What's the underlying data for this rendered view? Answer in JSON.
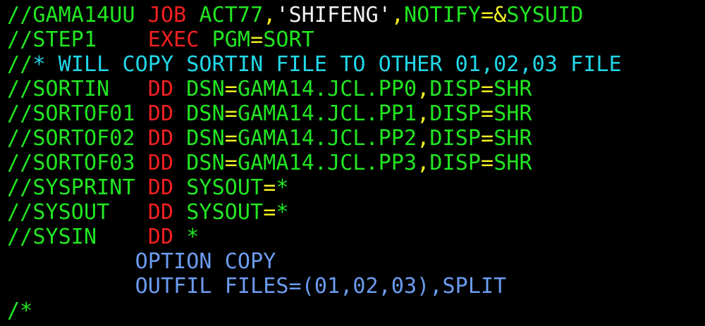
{
  "colors": {
    "background": "#000000",
    "green": "#22e622",
    "red": "#f22020",
    "yellow": "#f2f222",
    "cyan": "#22d8e8",
    "blue": "#6c9cf0",
    "white": "#f2f2f2"
  },
  "lines": [
    {
      "name": "jcl-job-card",
      "segments": [
        {
          "text": "//GAMA14UU ",
          "color": "green"
        },
        {
          "text": "JOB",
          "color": "red"
        },
        {
          "text": " ACT77",
          "color": "green"
        },
        {
          "text": ",",
          "color": "yellow"
        },
        {
          "text": "'SHIFENG'",
          "color": "white"
        },
        {
          "text": ",",
          "color": "yellow"
        },
        {
          "text": "NOTIFY",
          "color": "green"
        },
        {
          "text": "=&",
          "color": "yellow"
        },
        {
          "text": "SYSUID",
          "color": "green"
        }
      ]
    },
    {
      "name": "jcl-exec-step",
      "segments": [
        {
          "text": "//STEP1    ",
          "color": "green"
        },
        {
          "text": "EXEC",
          "color": "red"
        },
        {
          "text": " PGM",
          "color": "green"
        },
        {
          "text": "=",
          "color": "yellow"
        },
        {
          "text": "SORT",
          "color": "green"
        }
      ]
    },
    {
      "name": "jcl-comment",
      "segments": [
        {
          "text": "//",
          "color": "green"
        },
        {
          "text": "* WILL COPY SORTIN FILE TO OTHER 01,02,03 FILE",
          "color": "cyan"
        }
      ]
    },
    {
      "name": "jcl-dd-sortin",
      "segments": [
        {
          "text": "//SORTIN   ",
          "color": "green"
        },
        {
          "text": "DD",
          "color": "red"
        },
        {
          "text": " DSN",
          "color": "green"
        },
        {
          "text": "=",
          "color": "yellow"
        },
        {
          "text": "GAMA14.JCL.PP0",
          "color": "green"
        },
        {
          "text": ",",
          "color": "yellow"
        },
        {
          "text": "DISP",
          "color": "green"
        },
        {
          "text": "=",
          "color": "yellow"
        },
        {
          "text": "SHR",
          "color": "green"
        }
      ]
    },
    {
      "name": "jcl-dd-sortof01",
      "segments": [
        {
          "text": "//SORTOF01 ",
          "color": "green"
        },
        {
          "text": "DD",
          "color": "red"
        },
        {
          "text": " DSN",
          "color": "green"
        },
        {
          "text": "=",
          "color": "yellow"
        },
        {
          "text": "GAMA14.JCL.PP1",
          "color": "green"
        },
        {
          "text": ",",
          "color": "yellow"
        },
        {
          "text": "DISP",
          "color": "green"
        },
        {
          "text": "=",
          "color": "yellow"
        },
        {
          "text": "SHR",
          "color": "green"
        }
      ]
    },
    {
      "name": "jcl-dd-sortof02",
      "segments": [
        {
          "text": "//SORTOF02 ",
          "color": "green"
        },
        {
          "text": "DD",
          "color": "red"
        },
        {
          "text": " DSN",
          "color": "green"
        },
        {
          "text": "=",
          "color": "yellow"
        },
        {
          "text": "GAMA14.JCL.PP2",
          "color": "green"
        },
        {
          "text": ",",
          "color": "yellow"
        },
        {
          "text": "DISP",
          "color": "green"
        },
        {
          "text": "=",
          "color": "yellow"
        },
        {
          "text": "SHR",
          "color": "green"
        }
      ]
    },
    {
      "name": "jcl-dd-sortof03",
      "segments": [
        {
          "text": "//SORTOF03 ",
          "color": "green"
        },
        {
          "text": "DD",
          "color": "red"
        },
        {
          "text": " DSN",
          "color": "green"
        },
        {
          "text": "=",
          "color": "yellow"
        },
        {
          "text": "GAMA14.JCL.PP3",
          "color": "green"
        },
        {
          "text": ",",
          "color": "yellow"
        },
        {
          "text": "DISP",
          "color": "green"
        },
        {
          "text": "=",
          "color": "yellow"
        },
        {
          "text": "SHR",
          "color": "green"
        }
      ]
    },
    {
      "name": "jcl-dd-sysprint",
      "segments": [
        {
          "text": "//SYSPRINT ",
          "color": "green"
        },
        {
          "text": "DD",
          "color": "red"
        },
        {
          "text": " SYSOUT",
          "color": "green"
        },
        {
          "text": "=",
          "color": "yellow"
        },
        {
          "text": "*",
          "color": "green"
        }
      ]
    },
    {
      "name": "jcl-dd-sysout",
      "segments": [
        {
          "text": "//SYSOUT   ",
          "color": "green"
        },
        {
          "text": "DD",
          "color": "red"
        },
        {
          "text": " SYSOUT",
          "color": "green"
        },
        {
          "text": "=",
          "color": "yellow"
        },
        {
          "text": "*",
          "color": "green"
        }
      ]
    },
    {
      "name": "jcl-dd-sysin",
      "segments": [
        {
          "text": "//SYSIN    ",
          "color": "green"
        },
        {
          "text": "DD",
          "color": "red"
        },
        {
          "text": " *",
          "color": "green"
        }
      ]
    },
    {
      "name": "sort-option-copy",
      "segments": [
        {
          "text": "          OPTION COPY",
          "color": "blue"
        }
      ]
    },
    {
      "name": "sort-outfil-split",
      "segments": [
        {
          "text": "          OUTFIL FILES=(01,02,03),SPLIT",
          "color": "blue"
        }
      ]
    },
    {
      "name": "jcl-instream-end",
      "segments": [
        {
          "text": "/",
          "color": "green"
        },
        {
          "text": "*",
          "color": "green"
        }
      ]
    }
  ]
}
